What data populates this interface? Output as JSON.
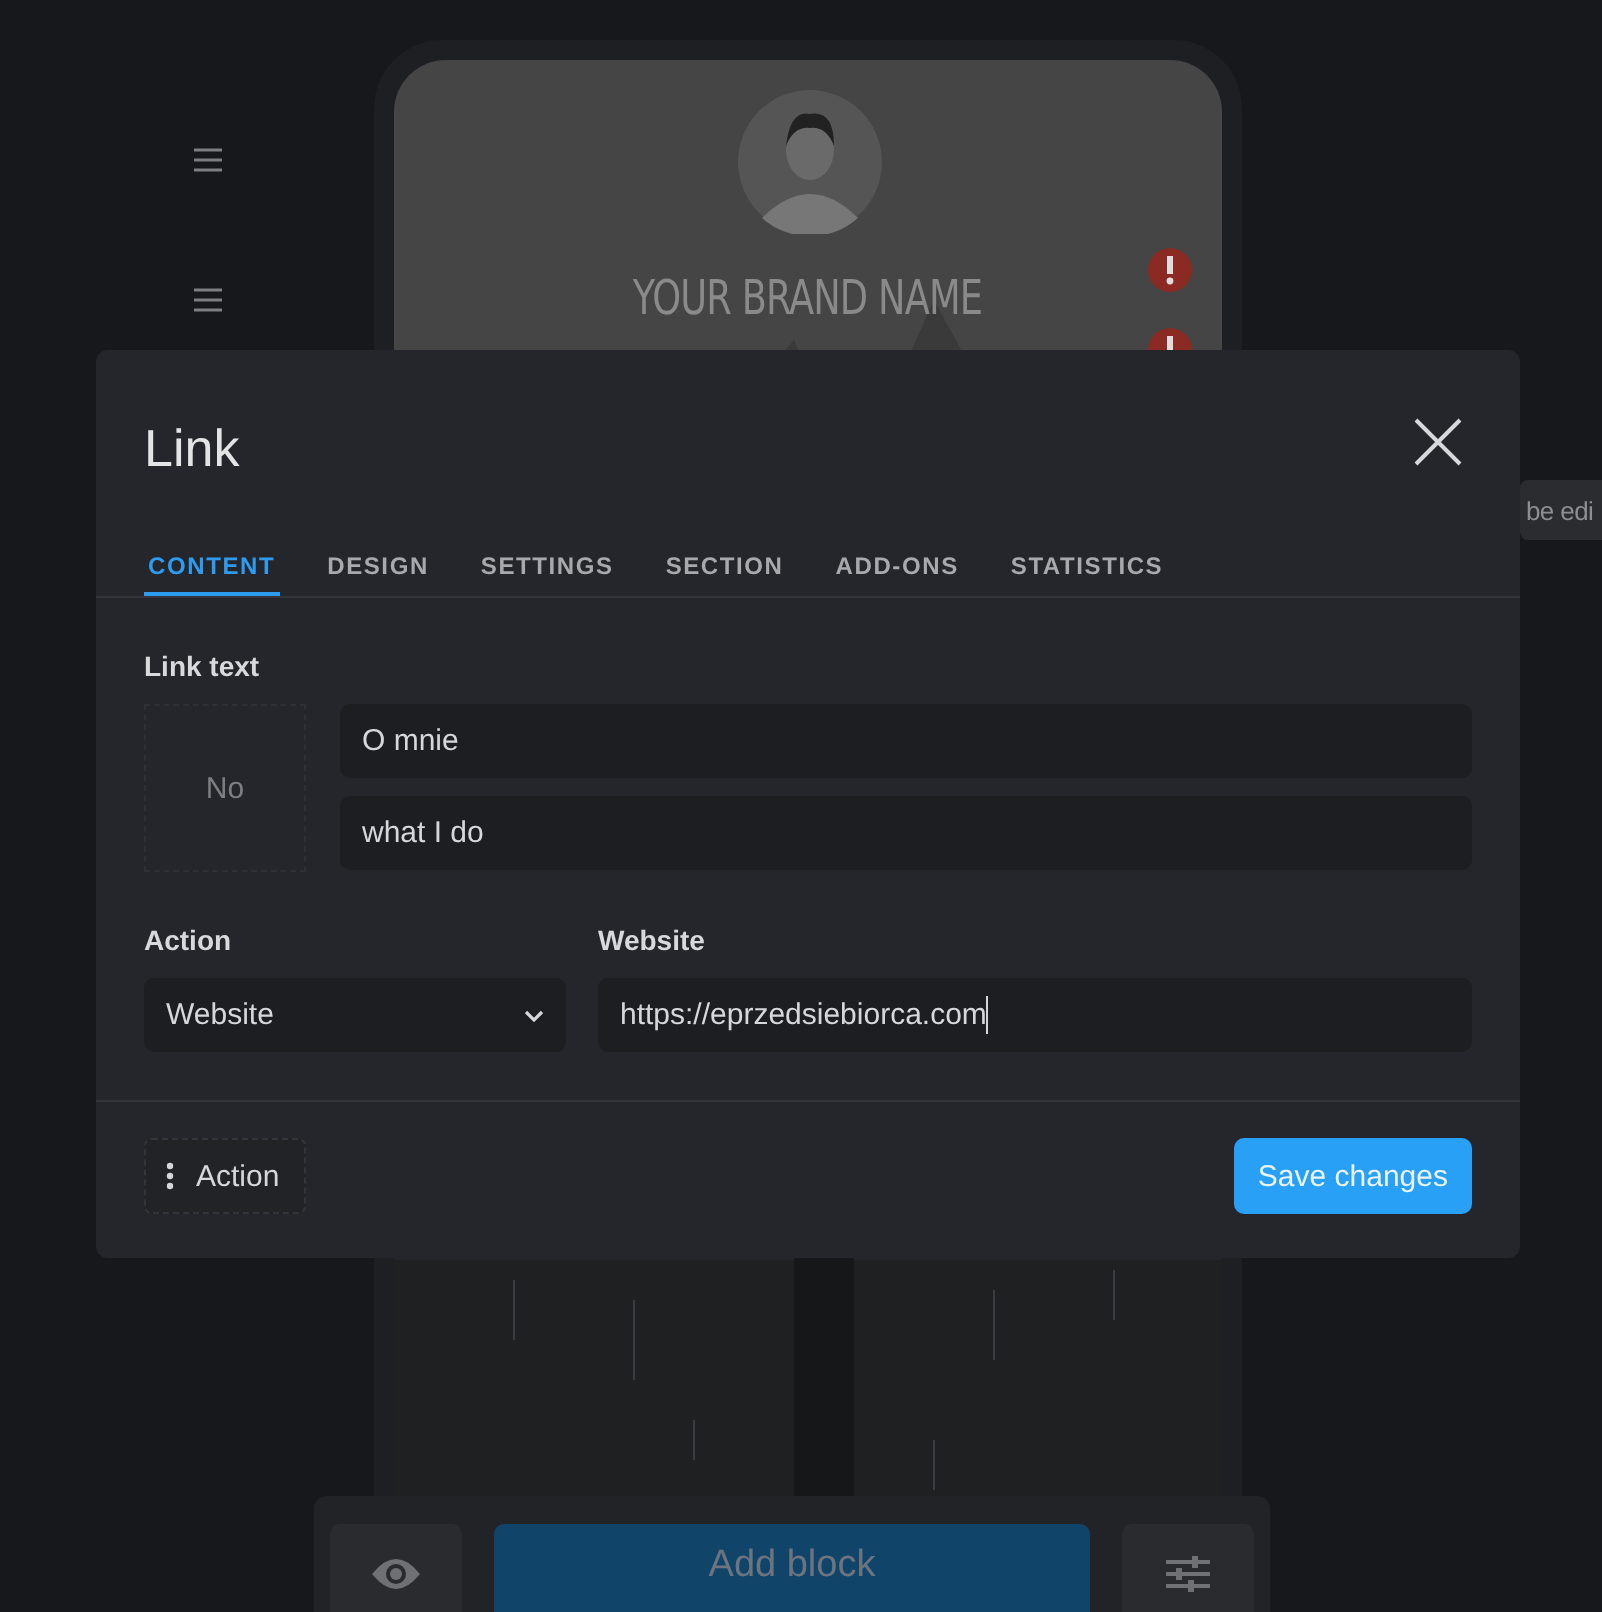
{
  "preview": {
    "brand_name": "YOUR BRAND NAME"
  },
  "tooltip": {
    "text": "be edi"
  },
  "toolbar": {
    "add_button": "Add block"
  },
  "modal": {
    "title": "Link",
    "tabs": [
      {
        "label": "CONTENT",
        "selected": true
      },
      {
        "label": "DESIGN",
        "selected": false
      },
      {
        "label": "SETTINGS",
        "selected": false
      },
      {
        "label": "SECTION",
        "selected": false
      },
      {
        "label": "ADD-ONS",
        "selected": false
      },
      {
        "label": "STATISTICS",
        "selected": false
      }
    ],
    "link_text": {
      "label": "Link text",
      "image_placeholder": "No",
      "values": [
        "O mnie",
        "what I do"
      ]
    },
    "action": {
      "label": "Action",
      "value": "Website"
    },
    "website": {
      "label": "Website",
      "value": "https://eprzedsiebiorca.com"
    },
    "footer": {
      "action_button": "Action",
      "save_button": "Save changes"
    }
  }
}
